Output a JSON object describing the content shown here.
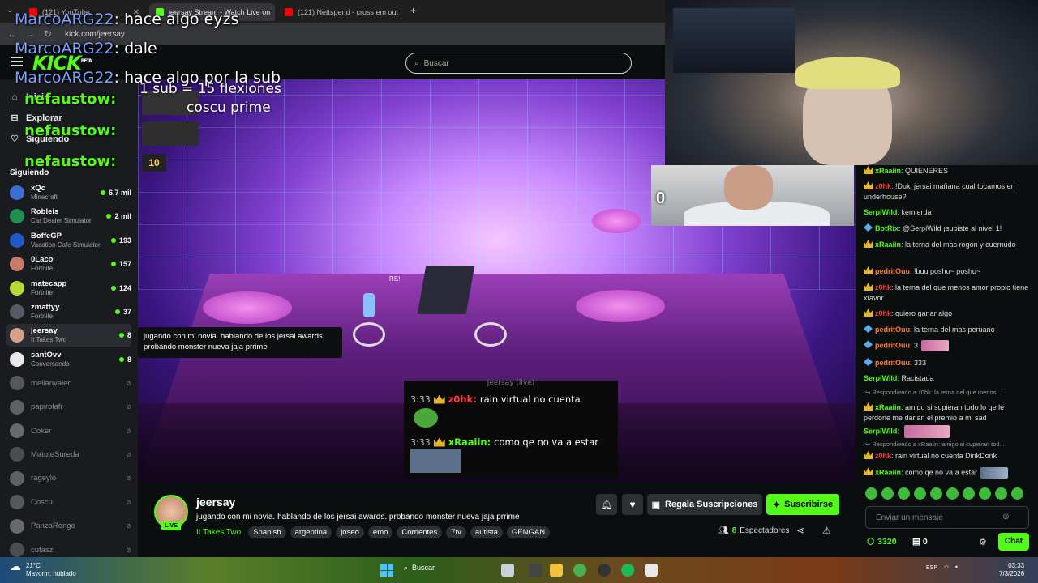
{
  "browser": {
    "tabs": [
      {
        "title": "(121) YouTube",
        "color": "#ff0000",
        "active": false
      },
      {
        "title": "jeersay Stream - Watch Live on",
        "color": "#53fc18",
        "active": true
      },
      {
        "title": "(121) Nettspend - cross em out",
        "color": "#ff0000",
        "active": false
      }
    ],
    "url": "kick.com/jeersay",
    "new_tab": "+"
  },
  "header": {
    "logo": "KICK",
    "logo_beta": "BETA",
    "search_placeholder": "Buscar"
  },
  "sidebar": {
    "nav": [
      {
        "label": "Inicio",
        "icon": "home-icon",
        "glyph": "⌂"
      },
      {
        "label": "Explorar",
        "icon": "compass-icon",
        "glyph": "⊟"
      },
      {
        "label": "Siguiendo",
        "icon": "heart-icon",
        "glyph": "♡"
      }
    ],
    "following_title": "Siguiendo",
    "channels": [
      {
        "name": "xQc",
        "game": "Minecraft",
        "viewers": "6,7 mil",
        "color": "#3b6fd1",
        "live": true
      },
      {
        "name": "Robleis",
        "game": "Car Dealer Simulator",
        "viewers": "2 mil",
        "color": "#1e8f4e",
        "live": true
      },
      {
        "name": "BoffeGP",
        "game": "Vacation Cafe Simulator",
        "viewers": "193",
        "color": "#2058c9",
        "live": true
      },
      {
        "name": "0Laco",
        "game": "Fortnite",
        "viewers": "157",
        "color": "#c77b6a",
        "live": true
      },
      {
        "name": "matecapp",
        "game": "Fortnite",
        "viewers": "124",
        "color": "#b6d936",
        "live": true
      },
      {
        "name": "zmattyy",
        "game": "Fortnite",
        "viewers": "37",
        "color": "#555a63",
        "live": true
      },
      {
        "name": "jeersay",
        "game": "It Takes Two",
        "viewers": "8",
        "color": "#d6a088",
        "live": true
      },
      {
        "name": "santOvv",
        "game": "Conversando",
        "viewers": "8",
        "color": "#e8e8e8",
        "live": true
      },
      {
        "name": "melianvalen",
        "game": "",
        "viewers": "",
        "color": "#888",
        "live": false
      },
      {
        "name": "papirolafr",
        "game": "",
        "viewers": "",
        "color": "#999",
        "live": false
      },
      {
        "name": "Coker",
        "game": "",
        "viewers": "",
        "color": "#aaa",
        "live": false
      },
      {
        "name": "MatuteSureda",
        "game": "",
        "viewers": "",
        "color": "#777",
        "live": false
      },
      {
        "name": "rageylo",
        "game": "",
        "viewers": "",
        "color": "#999",
        "live": false
      },
      {
        "name": "Coscu",
        "game": "",
        "viewers": "",
        "color": "#888",
        "live": false
      },
      {
        "name": "PanzaRengo",
        "game": "",
        "viewers": "",
        "color": "#aaa",
        "live": false
      },
      {
        "name": "cufasz",
        "game": "",
        "viewers": "",
        "color": "#777",
        "live": false
      }
    ]
  },
  "video": {
    "overlay_messages": [
      {
        "user": "MarcoARG22",
        "text": "hace algo eyzs"
      },
      {
        "user": "MarcoARG22",
        "text": "dale"
      },
      {
        "user": "MarcoARG22",
        "text": "hace algo por la sub"
      }
    ],
    "overlay_sub_lines": [
      "1 sub = 15 flexiones",
      "coscu prime"
    ],
    "alerts": [
      "nefaustow:",
      "nefaustow:",
      "nefaustow:"
    ],
    "tooltip": "jugando con mi novia. hablando de los jersai awards. probando monster nueva jaja prrime",
    "game_labels": [
      "RS!"
    ],
    "cam2_number": "0",
    "inner_chat_header": "jeersay (live)",
    "inner_chat": [
      {
        "time": "3:33",
        "user": "z0hk:",
        "text": "rain virtual no cuenta",
        "color": "#ff3b3b"
      },
      {
        "time": "3:33",
        "user": "xRaaiin:",
        "text": "como qe no va a estar",
        "color": "#53fc18"
      }
    ]
  },
  "stream": {
    "name": "jeersay",
    "live": "LIVE",
    "title": "jugando con mi novia. hablando de los jersai awards. probando monster nueva jaja prrime",
    "game": "It Takes Two",
    "tags": [
      "Spanish",
      "argentina",
      "joseo",
      "emo",
      "Corrientes",
      "7tv",
      "autista",
      "GENGAN"
    ],
    "gift_label": "Regala Suscripciones",
    "subscribe_label": "Suscribirse",
    "viewers": "8",
    "viewers_label": "Espectadores"
  },
  "chat": {
    "messages": [
      {
        "badge": "crown",
        "user": "xRaaiin",
        "color": "#53fc18",
        "text": "QUIENERES"
      },
      {
        "badge": "crown",
        "user": "z0hk",
        "color": "#ff3b3b",
        "text": "!Duki jersai mañana cual tocamos en underhouse?"
      },
      {
        "badge": "",
        "user": "SerpiWild",
        "color": "#53fc18",
        "text": "kemierda"
      },
      {
        "badge": "kick",
        "user": "BotRix",
        "color": "#53fc18",
        "text": "@SerpiWild ¡subiste al nivel 1!"
      },
      {
        "badge": "crown",
        "user": "xRaaiin",
        "color": "#53fc18",
        "text": "la terna del mas rogon y cuernudo"
      },
      {
        "badge": "crown",
        "user": "pedritOuu",
        "color": "#ff7a3b",
        "text": "!buu posho~ posho~"
      },
      {
        "badge": "crown",
        "user": "z0hk",
        "color": "#ff3b3b",
        "text": "la terna del que menos amor propio tiene xfavor"
      },
      {
        "badge": "crown",
        "user": "z0hk",
        "color": "#ff3b3b",
        "text": "quiero ganar algo"
      },
      {
        "badge": "kick",
        "user": "pedritOuu",
        "color": "#ff7a3b",
        "text": "la terna del mas peruano"
      },
      {
        "badge": "kick",
        "user": "pedritOuu",
        "color": "#ff7a3b",
        "text": "3"
      },
      {
        "badge": "kick",
        "user": "pedritOuu",
        "color": "#ff7a3b",
        "text": "333"
      },
      {
        "badge": "",
        "user": "SerpiWild",
        "color": "#53fc18",
        "text": "Racistada"
      },
      {
        "badge": "crown",
        "user": "xRaaiin",
        "color": "#53fc18",
        "text": "amigo si supieran todo lo qe le perdone me darian el premio a mi sad"
      },
      {
        "badge": "",
        "user": "SerpiWild",
        "color": "#53fc18",
        "text": ""
      },
      {
        "badge": "crown",
        "user": "z0hk",
        "color": "#ff3b3b",
        "text": "rain virtual no cuenta DinkDonk"
      },
      {
        "badge": "crown",
        "user": "xRaaiin",
        "color": "#53fc18",
        "text": "como qe no va a estar"
      }
    ],
    "replies": [
      "Respondiendo a z0hk: la terna del que menos ...",
      "Respondiendo a xRaaiin: amigo si supieran tod..."
    ],
    "input_placeholder": "Enviar un mensaje",
    "points": "3320",
    "chest": "0",
    "send_label": "Chat"
  },
  "taskbar": {
    "temp": "21°C",
    "weather": "Mayorm. nublado",
    "search": "Buscar",
    "lang": "ESP",
    "time": "03:33",
    "date": "7/3/2026"
  }
}
